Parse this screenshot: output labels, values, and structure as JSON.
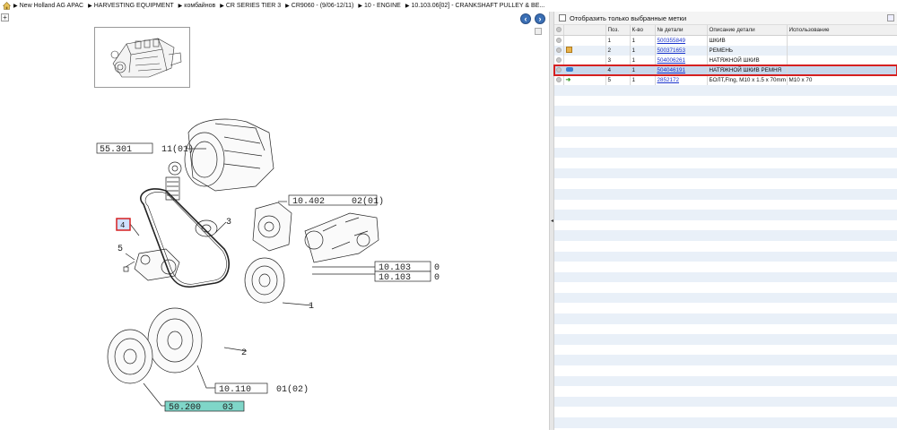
{
  "breadcrumb": {
    "items": [
      "New Holland AG APAC",
      "HARVESTING EQUIPMENT",
      "комбайнов",
      "CR SERIES TIER 3",
      "CR9060 - (9/06-12/11)",
      "10 - ENGINE",
      "10.103.06[02] - CRANKSHAFT PULLEY & BE..."
    ]
  },
  "nav": {
    "prev": "‹",
    "next": "›"
  },
  "zoom_label": "+",
  "diagram": {
    "callouts": {
      "c1": "55.301",
      "c1b": "11(01)",
      "c2": "10.402",
      "c2b": "02(01)",
      "c3a": "10.103",
      "c3b": "10.103",
      "c3c": "0",
      "c3d": "0",
      "c4": "10.110",
      "c4b": "01(02)",
      "c5": "50.200",
      "c5b": "03",
      "n1": "1",
      "n2": "2",
      "n3": "3",
      "n4": "4",
      "n5": "5"
    }
  },
  "parts_panel": {
    "filter_label": "Отобразить только выбранные метки",
    "columns": [
      "",
      "",
      "Поз.",
      "К-во",
      "№ детали",
      "Описание детали",
      "Использование"
    ],
    "rows": [
      {
        "icon": "circle",
        "pos": "1",
        "qty": "1",
        "part_no": "500355849",
        "desc": "ШКИВ",
        "usage": ""
      },
      {
        "icon": "box",
        "pos": "2",
        "qty": "1",
        "part_no": "500371653",
        "desc": "РЕМЕНЬ",
        "usage": ""
      },
      {
        "icon": "circle",
        "pos": "3",
        "qty": "1",
        "part_no": "504006261",
        "desc": "НАТЯЖНОЙ ШКИВ",
        "usage": ""
      },
      {
        "icon": "fish",
        "pos": "4",
        "qty": "1",
        "part_no": "504046191",
        "desc": "НАТЯЖНОЙ ШКИВ РЕМНЯ",
        "usage": ""
      },
      {
        "icon": "arrow",
        "pos": "5",
        "qty": "1",
        "part_no": "2852172",
        "desc": "БОЛТ,Flng, M10 x 1.5 x 70mm",
        "usage": "M10 x 70"
      }
    ]
  },
  "colors": {
    "selection_outline": "#d62020",
    "link": "#1a33cc",
    "highlight": "#7fd6c8"
  }
}
